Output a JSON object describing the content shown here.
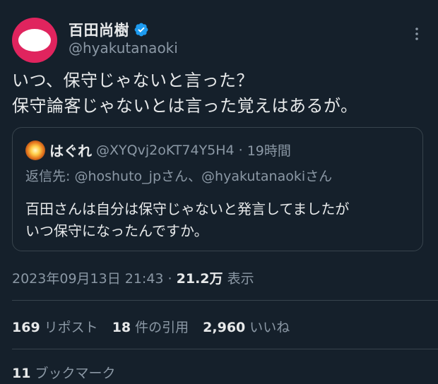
{
  "author": {
    "name": "百田尚樹",
    "handle": "@hyakutanaoki",
    "verified": true
  },
  "tweet": {
    "lines": [
      "いつ、保守じゃないと言った？",
      "保守論客じゃないとは言った覚えはあるが。"
    ]
  },
  "quote": {
    "name": "はぐれ",
    "handle": "@XYQvj2oKT74Y5H4",
    "dot": "·",
    "time": "19時間",
    "reply_prefix": "返信先: ",
    "reply_mention_1": "@hoshuto_jp",
    "reply_sep": "さん、",
    "reply_mention_2": "@hyakutanaoki",
    "reply_suffix": "さん",
    "body_lines": [
      "百田さんは自分は保守じゃないと発言してましたが",
      "いつ保守になったんですか。"
    ]
  },
  "meta": {
    "timestamp": "2023年09月13日 21:43",
    "dot": " · ",
    "views_count": "21.2万",
    "views_label": " 表示"
  },
  "stats": {
    "reposts_count": "169",
    "reposts_label": "リポスト",
    "quotes_count": "18",
    "quotes_label": "件の引用",
    "likes_count": "2,960",
    "likes_label": "いいね",
    "bookmarks_count": "11",
    "bookmarks_label": "ブックマーク"
  },
  "colors": {
    "background": "#15202b",
    "text": "#e7e9ea",
    "muted": "#8b98a5",
    "border": "#38444d",
    "verified": "#1d9bf0"
  }
}
